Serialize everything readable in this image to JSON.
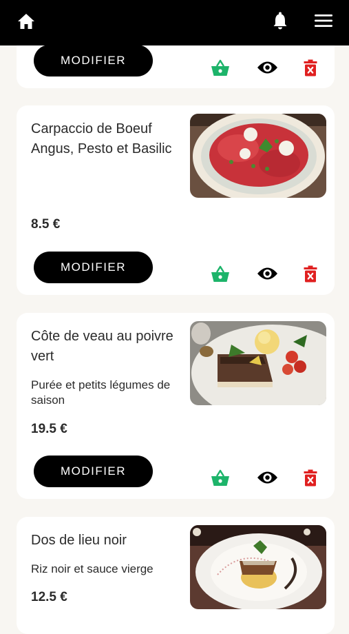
{
  "header": {
    "home_icon": "home-icon",
    "notifications_icon": "bell-icon",
    "menu_icon": "hamburger-menu-icon"
  },
  "colors": {
    "header_bg": "#000000",
    "basket": "#1db46a",
    "delete": "#e02020",
    "button_bg": "#000000"
  },
  "dishes": [
    {
      "name": "",
      "description": "",
      "price": "",
      "modify_label": "MODIFIER"
    },
    {
      "name": "Carpaccio de Boeuf Angus, Pesto et Basilic",
      "description": "",
      "price": "8.5 €",
      "modify_label": "MODIFIER"
    },
    {
      "name": "Côte de veau au poivre vert",
      "description": "Purée et petits légumes de saison",
      "price": "19.5 €",
      "modify_label": "MODIFIER"
    },
    {
      "name": "Dos de lieu noir",
      "description": "Riz noir et sauce vierge",
      "price": "12.5 €",
      "modify_label": "MODIFIER"
    }
  ]
}
